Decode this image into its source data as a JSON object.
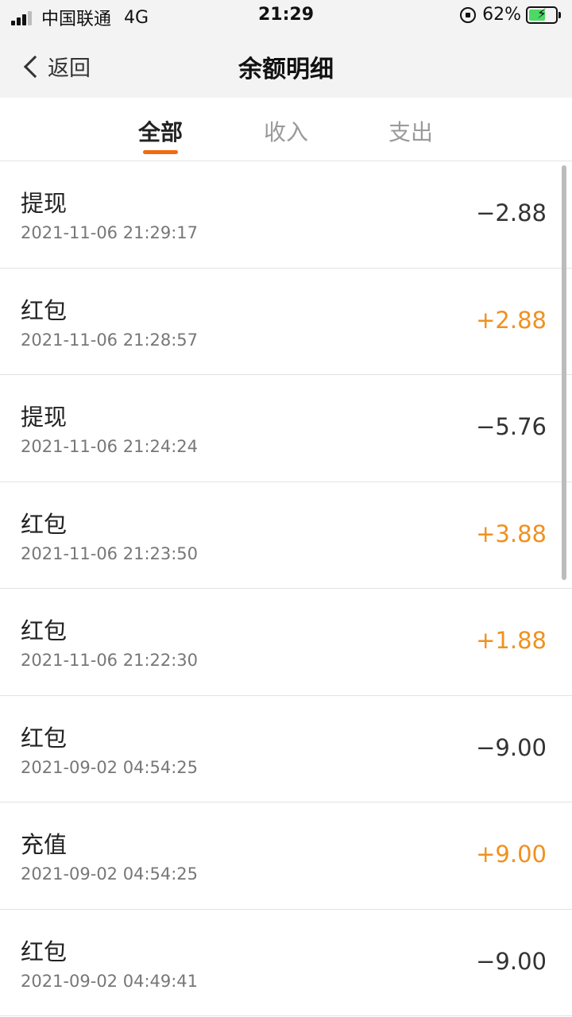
{
  "status_bar": {
    "carrier": "中国联通",
    "network": "4G",
    "time": "21:29",
    "battery": "62%",
    "battery_level": 0.62
  },
  "nav": {
    "back_label": "返回",
    "title": "余额明细"
  },
  "tabs": [
    {
      "label": "全部",
      "active": true
    },
    {
      "label": "收入",
      "active": false
    },
    {
      "label": "支出",
      "active": false
    }
  ],
  "colors": {
    "accent": "#f26a10",
    "income": "#f0911e"
  },
  "transactions": [
    {
      "title": "提现",
      "time": "2021-11-06 21:29:17",
      "amount": "−2.88",
      "positive": false
    },
    {
      "title": "红包",
      "time": "2021-11-06 21:28:57",
      "amount": "+2.88",
      "positive": true
    },
    {
      "title": "提现",
      "time": "2021-11-06 21:24:24",
      "amount": "−5.76",
      "positive": false
    },
    {
      "title": "红包",
      "time": "2021-11-06 21:23:50",
      "amount": "+3.88",
      "positive": true
    },
    {
      "title": "红包",
      "time": "2021-11-06 21:22:30",
      "amount": "+1.88",
      "positive": true
    },
    {
      "title": "红包",
      "time": "2021-09-02 04:54:25",
      "amount": "−9.00",
      "positive": false
    },
    {
      "title": "充值",
      "time": "2021-09-02 04:54:25",
      "amount": "+9.00",
      "positive": true
    },
    {
      "title": "红包",
      "time": "2021-09-02 04:49:41",
      "amount": "−9.00",
      "positive": false
    }
  ]
}
